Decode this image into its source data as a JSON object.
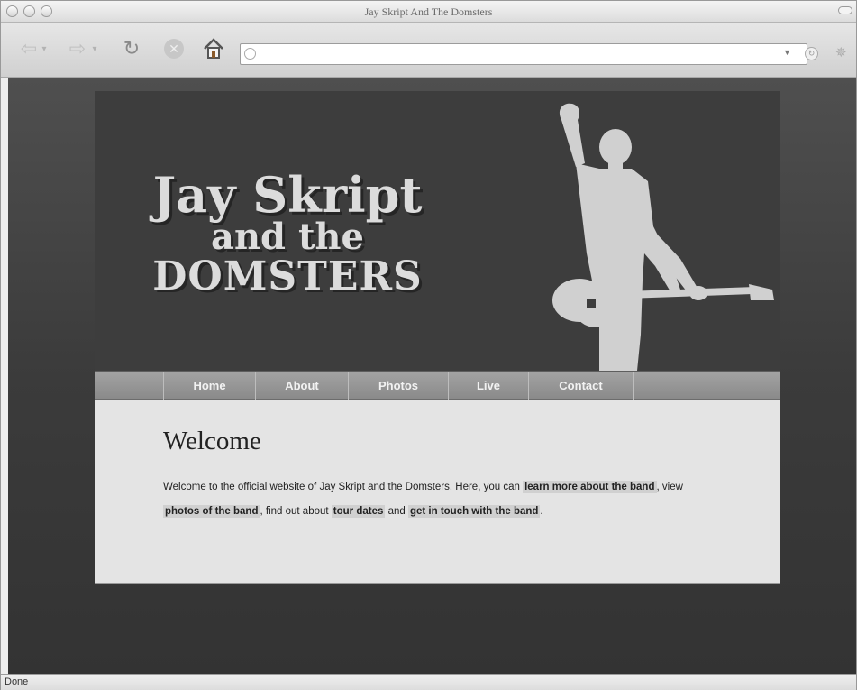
{
  "window": {
    "title": "Jay Skript And The Domsters"
  },
  "toolbar": {
    "url_value": ""
  },
  "site": {
    "logo": {
      "line1": "Jay Skript",
      "line2": "and the",
      "line3": "DOMSTERS"
    },
    "nav": {
      "items": [
        "Home",
        "About",
        "Photos",
        "Live",
        "Contact"
      ]
    },
    "welcome": {
      "title": "Welcome",
      "text_1": "Welcome to the official website of Jay Skript and the Domsters. Here, you can ",
      "link_1": "learn more about the band",
      "text_2": ", view ",
      "link_2": "photos of the band",
      "text_3": ", find out about ",
      "link_3": "tour dates",
      "text_4": " and ",
      "link_4": "get in touch with the band",
      "text_5": "."
    }
  },
  "status": {
    "text": "Done"
  },
  "colors": {
    "header_bg": "#3d3d3d",
    "page_bg": "#3b3b3b",
    "content_bg": "#e4e4e4",
    "nav_bg": "#969696",
    "silhouette": "#d0d0d0"
  },
  "icons": {
    "back": "back-arrow-icon",
    "forward": "forward-arrow-icon",
    "reload": "reload-icon",
    "stop": "stop-icon",
    "home": "home-icon"
  }
}
